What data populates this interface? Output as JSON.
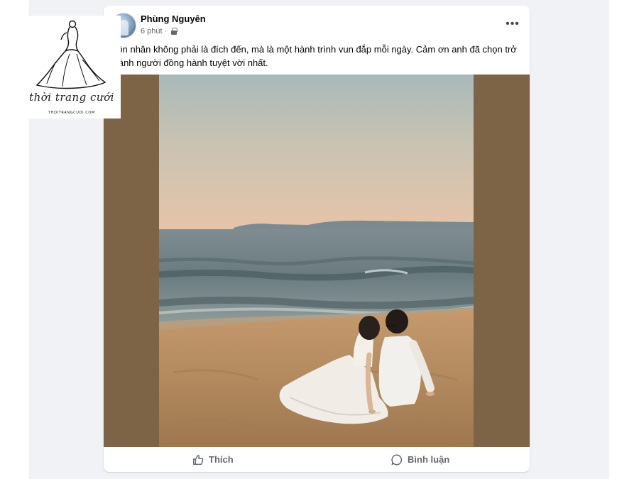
{
  "post": {
    "author": "Phùng Nguyên",
    "time": "6 phút",
    "separator": "·",
    "privacy_icon": "lock-icon",
    "more_label": "•••",
    "text": "Hôn nhân không phải là đích đến, mà là một hành trình vun đắp mỗi ngày. Cảm ơn anh đã chọn trở thành người đồng hành tuyệt vời nhất."
  },
  "actions": {
    "like_label": "Thích",
    "like_icon": "thumbs-up-icon",
    "comment_label": "Bình luận",
    "comment_icon": "comment-bubble-icon"
  },
  "watermark": {
    "brand": "thời trang cưới",
    "url": "THOITRANGCUOI.COM"
  },
  "colors": {
    "photo_letterbox": "#7d6446",
    "page_background": "#f0f2f5",
    "secondary_text": "#65676b"
  }
}
